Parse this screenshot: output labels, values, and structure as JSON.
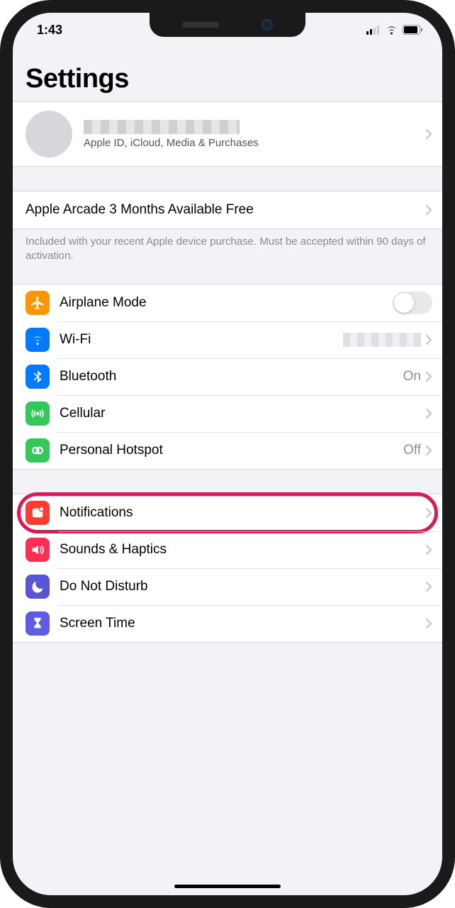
{
  "status": {
    "time": "1:43"
  },
  "header": {
    "title": "Settings"
  },
  "profile": {
    "subtitle": "Apple ID, iCloud, Media & Purchases"
  },
  "promo": {
    "title": "Apple Arcade 3 Months Available Free",
    "footer": "Included with your recent Apple device purchase. Must be accepted within 90 days of activation."
  },
  "group1": {
    "airplane": {
      "label": "Airplane Mode"
    },
    "wifi": {
      "label": "Wi-Fi"
    },
    "bluetooth": {
      "label": "Bluetooth",
      "value": "On"
    },
    "cellular": {
      "label": "Cellular"
    },
    "hotspot": {
      "label": "Personal Hotspot",
      "value": "Off"
    }
  },
  "group2": {
    "notifications": {
      "label": "Notifications"
    },
    "sounds": {
      "label": "Sounds & Haptics"
    },
    "dnd": {
      "label": "Do Not Disturb"
    },
    "screentime": {
      "label": "Screen Time"
    }
  }
}
